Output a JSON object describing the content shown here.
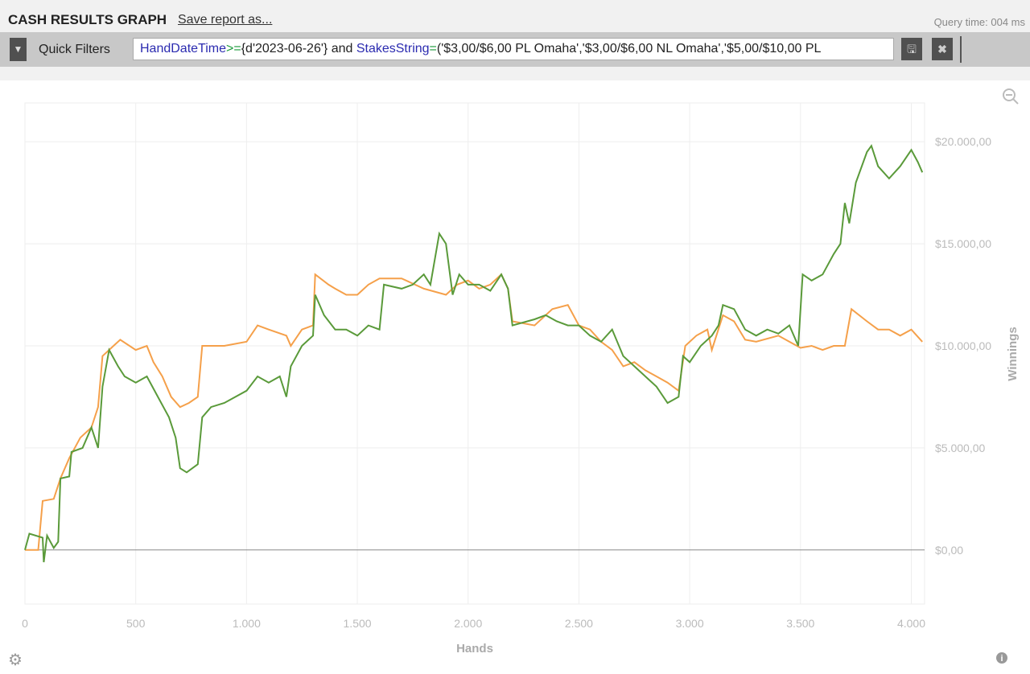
{
  "header": {
    "title": "CASH RESULTS GRAPH",
    "save_label": "Save report as...",
    "query_time": "Query time: 004 ms"
  },
  "filters": {
    "label": "Quick Filters",
    "query_parts": [
      {
        "t": "HandDateTime",
        "c": "kw"
      },
      {
        "t": ">=",
        "c": "op"
      },
      {
        "t": "{d'2023-06-26'} and ",
        "c": ""
      },
      {
        "t": "StakesString",
        "c": "kw"
      },
      {
        "t": "=",
        "c": "op"
      },
      {
        "t": "('$3,00/$6,00 PL Omaha','$3,00/$6,00 NL Omaha','$5,00/$10,00 PL",
        "c": ""
      }
    ]
  },
  "chart_data": {
    "type": "line",
    "xlabel": "Hands",
    "ylabel": "Winnings",
    "xlim": [
      0,
      4060
    ],
    "ylim": [
      -2650,
      21900
    ],
    "x_ticks": [
      0,
      500,
      1000,
      1500,
      2000,
      2500,
      3000,
      3500,
      4000
    ],
    "x_tick_labels": [
      "0",
      "500",
      "1.000",
      "1.500",
      "2.000",
      "2.500",
      "3.000",
      "3.500",
      "4.000"
    ],
    "y_ticks": [
      0,
      5000,
      10000,
      15000,
      20000
    ],
    "y_tick_labels": [
      "$0,00",
      "$5.000,00",
      "$10.000,00",
      "$15.000,00",
      "$20.000,00"
    ],
    "series": [
      {
        "name": "winnings-green",
        "color": "#5a9a3a",
        "points": [
          [
            0,
            0
          ],
          [
            20,
            800
          ],
          [
            80,
            600
          ],
          [
            85,
            -600
          ],
          [
            100,
            700
          ],
          [
            130,
            100
          ],
          [
            150,
            400
          ],
          [
            160,
            3500
          ],
          [
            200,
            3600
          ],
          [
            210,
            4800
          ],
          [
            260,
            5000
          ],
          [
            300,
            6000
          ],
          [
            330,
            5000
          ],
          [
            350,
            8000
          ],
          [
            380,
            9800
          ],
          [
            420,
            9000
          ],
          [
            450,
            8500
          ],
          [
            500,
            8200
          ],
          [
            550,
            8500
          ],
          [
            600,
            7500
          ],
          [
            650,
            6500
          ],
          [
            680,
            5500
          ],
          [
            700,
            4000
          ],
          [
            730,
            3800
          ],
          [
            780,
            4200
          ],
          [
            800,
            6500
          ],
          [
            840,
            7000
          ],
          [
            900,
            7200
          ],
          [
            1000,
            7800
          ],
          [
            1050,
            8500
          ],
          [
            1100,
            8200
          ],
          [
            1150,
            8500
          ],
          [
            1180,
            7500
          ],
          [
            1200,
            9000
          ],
          [
            1250,
            10000
          ],
          [
            1300,
            10500
          ],
          [
            1310,
            12500
          ],
          [
            1350,
            11500
          ],
          [
            1400,
            10800
          ],
          [
            1450,
            10800
          ],
          [
            1500,
            10500
          ],
          [
            1550,
            11000
          ],
          [
            1600,
            10800
          ],
          [
            1620,
            13000
          ],
          [
            1700,
            12800
          ],
          [
            1750,
            13000
          ],
          [
            1800,
            13500
          ],
          [
            1830,
            13000
          ],
          [
            1870,
            15500
          ],
          [
            1900,
            15000
          ],
          [
            1930,
            12500
          ],
          [
            1960,
            13500
          ],
          [
            2000,
            13000
          ],
          [
            2050,
            13000
          ],
          [
            2100,
            12700
          ],
          [
            2150,
            13500
          ],
          [
            2180,
            12800
          ],
          [
            2200,
            11000
          ],
          [
            2300,
            11300
          ],
          [
            2350,
            11500
          ],
          [
            2400,
            11200
          ],
          [
            2450,
            11000
          ],
          [
            2500,
            11000
          ],
          [
            2550,
            10500
          ],
          [
            2600,
            10200
          ],
          [
            2650,
            10800
          ],
          [
            2700,
            9500
          ],
          [
            2750,
            9000
          ],
          [
            2800,
            8500
          ],
          [
            2850,
            8000
          ],
          [
            2900,
            7200
          ],
          [
            2950,
            7500
          ],
          [
            2970,
            9500
          ],
          [
            3000,
            9200
          ],
          [
            3050,
            10000
          ],
          [
            3100,
            10500
          ],
          [
            3130,
            11000
          ],
          [
            3150,
            12000
          ],
          [
            3200,
            11800
          ],
          [
            3250,
            10800
          ],
          [
            3300,
            10500
          ],
          [
            3350,
            10800
          ],
          [
            3400,
            10600
          ],
          [
            3450,
            11000
          ],
          [
            3490,
            10000
          ],
          [
            3510,
            13500
          ],
          [
            3550,
            13200
          ],
          [
            3600,
            13500
          ],
          [
            3650,
            14500
          ],
          [
            3680,
            15000
          ],
          [
            3700,
            17000
          ],
          [
            3720,
            16000
          ],
          [
            3750,
            18000
          ],
          [
            3800,
            19500
          ],
          [
            3820,
            19800
          ],
          [
            3850,
            18800
          ],
          [
            3900,
            18200
          ],
          [
            3950,
            18800
          ],
          [
            4000,
            19600
          ],
          [
            4030,
            19000
          ],
          [
            4050,
            18500
          ]
        ]
      },
      {
        "name": "winnings-orange",
        "color": "#f5a04a",
        "points": [
          [
            0,
            0
          ],
          [
            60,
            0
          ],
          [
            80,
            2400
          ],
          [
            130,
            2500
          ],
          [
            160,
            3500
          ],
          [
            200,
            4500
          ],
          [
            250,
            5500
          ],
          [
            300,
            6000
          ],
          [
            330,
            7000
          ],
          [
            350,
            9500
          ],
          [
            400,
            10000
          ],
          [
            430,
            10300
          ],
          [
            500,
            9800
          ],
          [
            550,
            10000
          ],
          [
            580,
            9200
          ],
          [
            620,
            8500
          ],
          [
            660,
            7500
          ],
          [
            700,
            7000
          ],
          [
            740,
            7200
          ],
          [
            780,
            7500
          ],
          [
            800,
            10000
          ],
          [
            900,
            10000
          ],
          [
            1000,
            10200
          ],
          [
            1050,
            11000
          ],
          [
            1100,
            10800
          ],
          [
            1180,
            10500
          ],
          [
            1200,
            10000
          ],
          [
            1250,
            10800
          ],
          [
            1300,
            11000
          ],
          [
            1310,
            13500
          ],
          [
            1370,
            13000
          ],
          [
            1400,
            12800
          ],
          [
            1450,
            12500
          ],
          [
            1500,
            12500
          ],
          [
            1550,
            13000
          ],
          [
            1600,
            13300
          ],
          [
            1700,
            13300
          ],
          [
            1800,
            12800
          ],
          [
            1900,
            12500
          ],
          [
            1950,
            13000
          ],
          [
            2000,
            13200
          ],
          [
            2050,
            12800
          ],
          [
            2100,
            13000
          ],
          [
            2150,
            13500
          ],
          [
            2180,
            12800
          ],
          [
            2200,
            11200
          ],
          [
            2300,
            11000
          ],
          [
            2380,
            11800
          ],
          [
            2450,
            12000
          ],
          [
            2500,
            11000
          ],
          [
            2550,
            10800
          ],
          [
            2600,
            10200
          ],
          [
            2650,
            9800
          ],
          [
            2700,
            9000
          ],
          [
            2750,
            9200
          ],
          [
            2800,
            8800
          ],
          [
            2850,
            8500
          ],
          [
            2900,
            8200
          ],
          [
            2950,
            7800
          ],
          [
            2980,
            10000
          ],
          [
            3030,
            10500
          ],
          [
            3080,
            10800
          ],
          [
            3100,
            9800
          ],
          [
            3150,
            11500
          ],
          [
            3200,
            11200
          ],
          [
            3250,
            10300
          ],
          [
            3300,
            10200
          ],
          [
            3400,
            10500
          ],
          [
            3450,
            10200
          ],
          [
            3500,
            9900
          ],
          [
            3550,
            10000
          ],
          [
            3600,
            9800
          ],
          [
            3650,
            10000
          ],
          [
            3700,
            10000
          ],
          [
            3730,
            11800
          ],
          [
            3800,
            11200
          ],
          [
            3850,
            10800
          ],
          [
            3900,
            10800
          ],
          [
            3950,
            10500
          ],
          [
            4000,
            10800
          ],
          [
            4050,
            10200
          ]
        ]
      }
    ]
  }
}
